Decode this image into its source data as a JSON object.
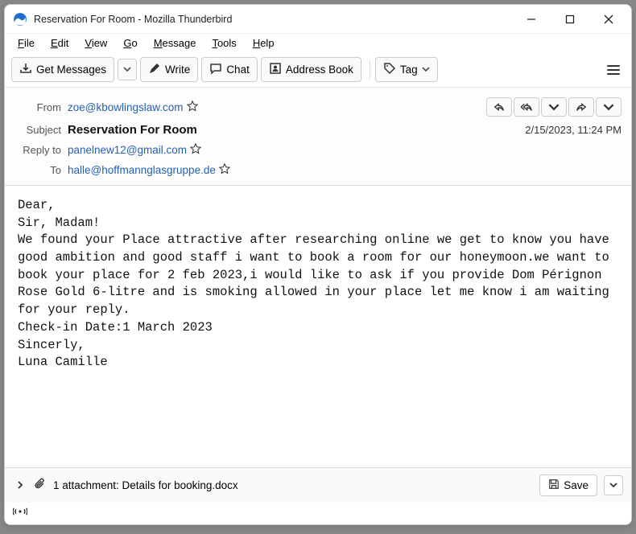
{
  "titlebar": {
    "title": "Reservation For Room - Mozilla Thunderbird"
  },
  "menu": {
    "file": "File",
    "edit": "Edit",
    "view": "View",
    "go": "Go",
    "message": "Message",
    "tools": "Tools",
    "help": "Help"
  },
  "toolbar": {
    "get_messages": "Get Messages",
    "write": "Write",
    "chat": "Chat",
    "address_book": "Address Book",
    "tag": "Tag"
  },
  "header": {
    "from_label": "From",
    "from": "zoe@kbowlingslaw.com",
    "subject_label": "Subject",
    "subject": "Reservation For Room",
    "reply_to_label": "Reply to",
    "reply_to": "panelnew12@gmail.com",
    "to_label": "To",
    "to": "halle@hoffmannglasgruppe.de",
    "date": "2/15/2023, 11:24 PM"
  },
  "body": "Dear,\nSir, Madam!\nWe found your Place attractive after researching online we get to know you have good ambition and good staff i want to book a room for our honeymoon.we want to book your place for 2 feb 2023,i would like to ask if you provide Dom Pérignon Rose Gold 6-litre and is smoking allowed in your place let me know i am waiting for your reply.\nCheck-in Date:1 March 2023\nSincerly,\nLuna Camille",
  "attachment": {
    "summary": "1 attachment: Details for booking.docx",
    "save": "Save"
  }
}
